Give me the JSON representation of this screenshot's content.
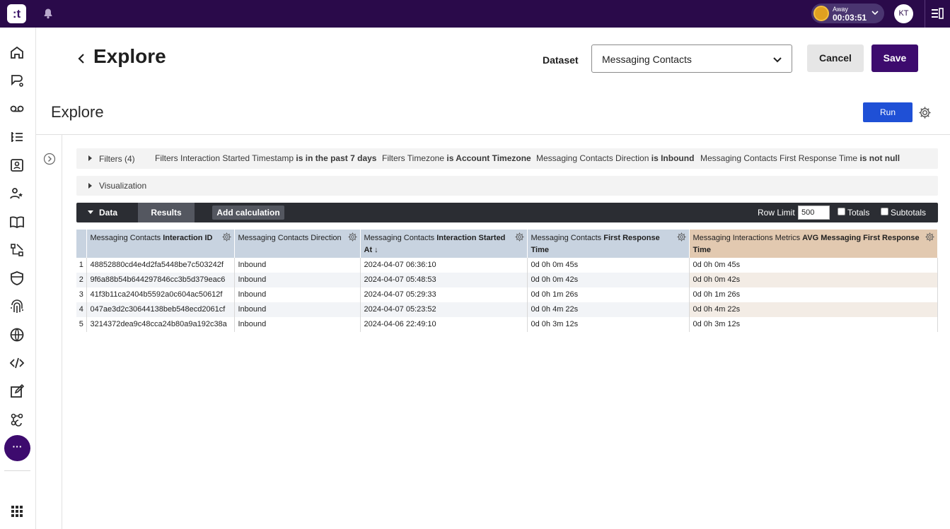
{
  "topbar": {
    "logo_text": ":t",
    "status": {
      "label": "Away",
      "time": "00:03:51"
    },
    "avatar_initials": "KT"
  },
  "sidebar": {
    "items": [
      "home-icon",
      "conversations-icon",
      "voicemail-icon",
      "list-icon",
      "contacts-icon",
      "users-icon",
      "knowledge-icon",
      "workflow-icon",
      "shield-icon",
      "fingerprint-icon",
      "globe-icon",
      "code-icon",
      "edit-icon",
      "integrations-icon"
    ],
    "more_label": "···"
  },
  "header": {
    "title": "Explore",
    "dataset_label": "Dataset",
    "dataset_value": "Messaging Contacts",
    "cancel_label": "Cancel",
    "save_label": "Save"
  },
  "explore": {
    "title": "Explore",
    "run_label": "Run",
    "filters": {
      "label": "Filters (4)",
      "chips": [
        {
          "field": "Filters Interaction Started Timestamp",
          "condition": "is in the past 7 days"
        },
        {
          "field": "Filters Timezone",
          "condition": "is Account Timezone"
        },
        {
          "field": "Messaging Contacts Direction",
          "condition": "is Inbound"
        },
        {
          "field": "Messaging Contacts First Response Time",
          "condition": "is not null"
        }
      ]
    },
    "visualization_label": "Visualization",
    "data_bar": {
      "data_label": "Data",
      "results_label": "Results",
      "add_calc_label": "Add calculation",
      "row_limit_label": "Row Limit",
      "row_limit_value": "500",
      "totals_label": "Totals",
      "subtotals_label": "Subtotals"
    },
    "table": {
      "columns": [
        {
          "prefix": "Messaging Contacts ",
          "bold": "Interaction ID",
          "type": "dimension"
        },
        {
          "prefix": "Messaging Contacts Direction",
          "bold": "",
          "type": "dimension"
        },
        {
          "prefix": "Messaging Contacts ",
          "bold": "Interaction Started At ↓",
          "type": "dimension"
        },
        {
          "prefix": "Messaging Contacts ",
          "bold": "First Response Time",
          "type": "dimension"
        },
        {
          "prefix": "Messaging Interactions Metrics ",
          "bold": "AVG Messaging First Response Time",
          "type": "measure"
        }
      ],
      "rows": [
        {
          "n": "1",
          "cells": [
            "48852880cd4e4d2fa5448be7c503242f",
            "Inbound",
            "2024-04-07 06:36:10",
            "0d 0h 0m 45s",
            "0d 0h 0m 45s"
          ]
        },
        {
          "n": "2",
          "cells": [
            "9f6a88b54b644297846cc3b5d379eac6",
            "Inbound",
            "2024-04-07 05:48:53",
            "0d 0h 0m 42s",
            "0d 0h 0m 42s"
          ]
        },
        {
          "n": "3",
          "cells": [
            "41f3b11ca2404b5592a0c604ac50612f",
            "Inbound",
            "2024-04-07 05:29:33",
            "0d 0h 1m 26s",
            "0d 0h 1m 26s"
          ]
        },
        {
          "n": "4",
          "cells": [
            "047ae3d2c30644138beb548ecd2061cf",
            "Inbound",
            "2024-04-07 05:23:52",
            "0d 0h 4m 22s",
            "0d 0h 4m 22s"
          ]
        },
        {
          "n": "5",
          "cells": [
            "3214372dea9c48cca24b80a9a192c38a",
            "Inbound",
            "2024-04-06 22:49:10",
            "0d 0h 3m 12s",
            "0d 0h 3m 12s"
          ]
        }
      ]
    }
  },
  "colors": {
    "topbar": "#2a0a4a",
    "primary": "#3d0b6e",
    "run": "#1f50d6",
    "dimension_header": "#c8d3e0",
    "measure_header": "#e2c9b0"
  }
}
